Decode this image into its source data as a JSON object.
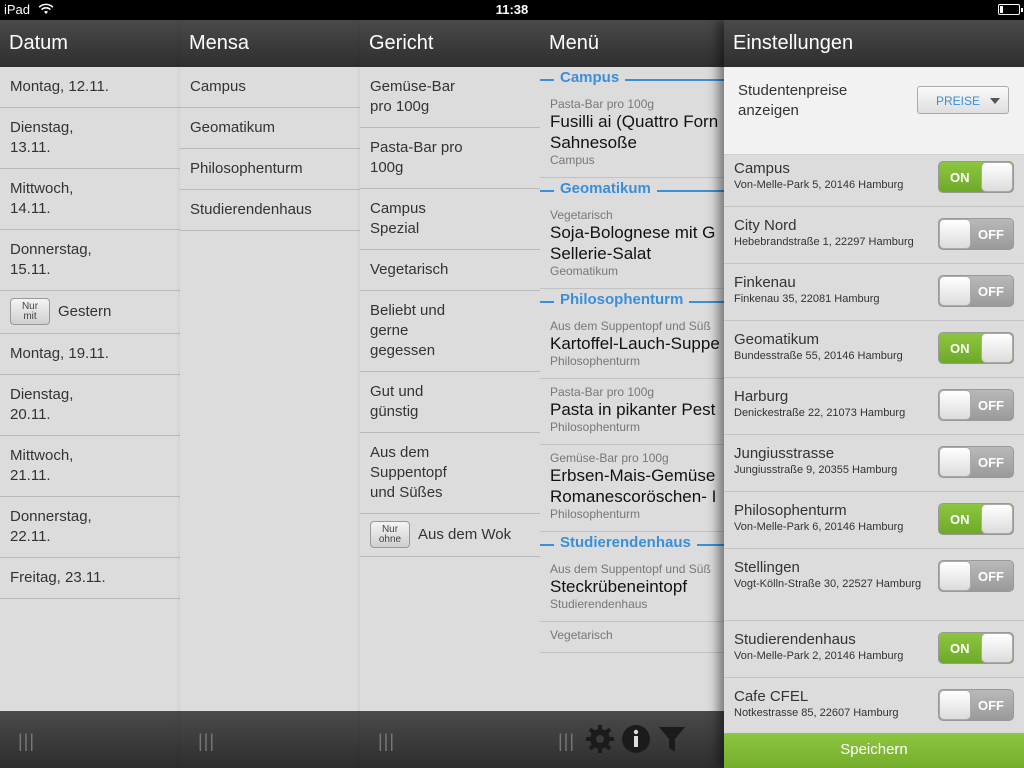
{
  "status_bar": {
    "device": "iPad",
    "time": "11:38"
  },
  "datum": {
    "title": "Datum",
    "items": [
      {
        "label": "Montag, 12.11."
      },
      {
        "label": "Dienstag,\n13.11."
      },
      {
        "label": "Mittwoch,\n14.11."
      },
      {
        "label": "Donnerstag,\n15.11."
      },
      {
        "label": "Gestern",
        "tag": "Nur\nmit"
      },
      {
        "label": "Montag, 19.11."
      },
      {
        "label": "Dienstag,\n20.11."
      },
      {
        "label": "Mittwoch,\n21.11."
      },
      {
        "label": "Donnerstag,\n22.11."
      },
      {
        "label": "Freitag, 23.11."
      }
    ]
  },
  "mensa": {
    "title": "Mensa",
    "items": [
      "Campus",
      "Geomatikum",
      "Philosophenturm",
      "Studierendenhaus"
    ]
  },
  "gericht": {
    "title": "Gericht",
    "items": [
      {
        "label": "Gemüse-Bar\npro 100g"
      },
      {
        "label": "Pasta-Bar pro\n100g"
      },
      {
        "label": "Campus\nSpezial"
      },
      {
        "label": "Vegetarisch"
      },
      {
        "label": "Beliebt und\ngerne\ngegessen"
      },
      {
        "label": "Gut und\ngünstig"
      },
      {
        "label": "Aus dem\nSuppentopf\nund Süßes"
      },
      {
        "label": "Aus dem Wok",
        "tag": "Nur\nohne"
      }
    ]
  },
  "menu": {
    "title": "Menü",
    "sections": [
      {
        "label": "Campus",
        "items": [
          {
            "category": "Pasta-Bar pro 100g",
            "name": "Fusilli ai (Quattro Forn\nSahnesoße",
            "location": "Campus"
          }
        ]
      },
      {
        "label": "Geomatikum",
        "items": [
          {
            "category": "Vegetarisch",
            "name": "Soja-Bolognese mit G\nSellerie-Salat",
            "location": "Geomatikum"
          }
        ]
      },
      {
        "label": "Philosophenturm",
        "items": [
          {
            "category": "Aus dem Suppentopf und Süß",
            "name": "Kartoffel-Lauch-Suppe",
            "location": "Philosophenturm"
          },
          {
            "category": "Pasta-Bar pro 100g",
            "name": "Pasta in pikanter Pest",
            "location": "Philosophenturm"
          },
          {
            "category": "Gemüse-Bar pro 100g",
            "name": "Erbsen-Mais-Gemüse\nRomanescoröschen- I",
            "location": "Philosophenturm"
          }
        ]
      },
      {
        "label": "Studierendenhaus",
        "items": [
          {
            "category": "Aus dem Suppentopf und Süß",
            "name": "Steckrübeneintopf",
            "location": "Studierendenhaus"
          },
          {
            "category": "Vegetarisch",
            "name": "",
            "location": ""
          }
        ]
      }
    ],
    "footer_icons": [
      "gear-icon",
      "info-icon",
      "filter-icon"
    ]
  },
  "settings": {
    "title": "Einstellungen",
    "price_label": "Studentenpreise\nanzeigen",
    "price_select": "PREISE",
    "on_label": "ON",
    "off_label": "OFF",
    "save_label": "Speichern",
    "mensen": [
      {
        "name": "Campus",
        "address": "Von-Melle-Park 5, 20146 Hamburg",
        "on": true
      },
      {
        "name": "City Nord",
        "address": "Hebebrandstraße 1, 22297 Hamburg",
        "on": false
      },
      {
        "name": "Finkenau",
        "address": "Finkenau 35, 22081 Hamburg",
        "on": false
      },
      {
        "name": "Geomatikum",
        "address": "Bundesstraße 55, 20146 Hamburg",
        "on": true
      },
      {
        "name": "Harburg",
        "address": "Denickestraße 22, 21073 Hamburg",
        "on": false
      },
      {
        "name": "Jungiusstrasse",
        "address": "Jungiusstraße 9, 20355 Hamburg",
        "on": false
      },
      {
        "name": "Philosophenturm",
        "address": "Von-Melle-Park 6, 20146 Hamburg",
        "on": true
      },
      {
        "name": "Stellingen",
        "address": "Vogt-Kölln-Straße 30, 22527 Hamburg",
        "on": false
      },
      {
        "name": "Studierendenhaus",
        "address": "Von-Melle-Park 2, 20146 Hamburg",
        "on": true
      },
      {
        "name": "Cafe CFEL",
        "address": "Notkestrasse 85, 22607 Hamburg",
        "on": false
      }
    ]
  }
}
